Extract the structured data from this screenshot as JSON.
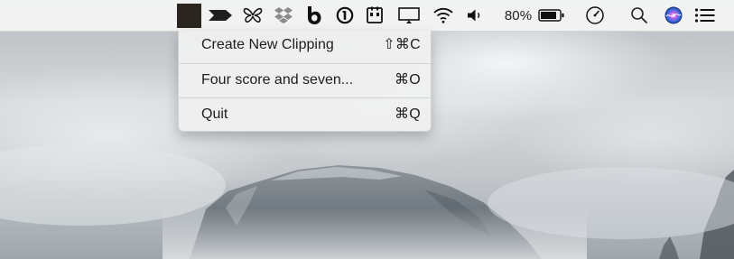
{
  "desktop": {
    "wallpaper": "cloudy-mountain-dome"
  },
  "menubar": {
    "icons": [
      "active-app-slot",
      "double-arrow-icon",
      "butterfly-icon",
      "dropbox-icon",
      "b-icon",
      "1password-icon",
      "calendar-icon",
      "display-icon",
      "wifi-icon",
      "volume-icon",
      "battery-icon",
      "speedometer-icon",
      "search-icon",
      "siri-icon",
      "list-icon"
    ],
    "battery_percent": "80%"
  },
  "menu": {
    "items": [
      {
        "label": "Create New Clipping",
        "shortcut": "⇧⌘C"
      },
      {
        "label": "Four score and seven...",
        "shortcut": "⌘O"
      },
      {
        "label": "Quit",
        "shortcut": "⌘Q"
      }
    ]
  },
  "colors": {
    "menubar_bg": "#f4f4f4",
    "active_slot": "#2b2520",
    "menu_bg": "#f0f0f0",
    "text": "#1d1d1d"
  }
}
